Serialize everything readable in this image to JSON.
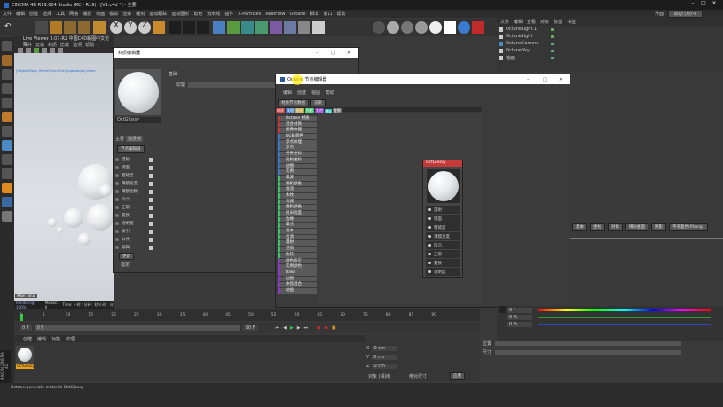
{
  "app": {
    "title": "CINEMA 4D R19.024 Studio (RC - R19) - [V1.c4d *] - 主要",
    "layout_label": "界面:",
    "layout_value": "启动 (用户)"
  },
  "menubar": [
    "文件",
    "编辑",
    "创建",
    "选择",
    "工具",
    "网格",
    "捕捉",
    "动画",
    "模拟",
    "渲染",
    "雕刻",
    "运动跟踪",
    "运动图形",
    "角色",
    "流水线",
    "插件",
    "X-Particles",
    "RealFlow",
    "Octane",
    "脚本",
    "窗口",
    "帮助"
  ],
  "viewport": {
    "header": "Live Viewer 3.07-R2 中国C4D新图中文论坛",
    "menu": [
      "文件",
      "云端",
      "材质",
      "比较",
      "选项",
      "帮助"
    ],
    "status_line": "[Object/Opic: Mesh/Gen:Ohm] update(all).done",
    "rendering_label": "Rendering: 100%",
    "ms_label": "Ms/sec: 0",
    "time_label": "Time: 小时 : 分钟 : 秒/小时 : 分钟 : 秒",
    "badge": "Main Tonal"
  },
  "material_editor": {
    "title": "材质编辑器",
    "name": "OctGlossy",
    "filter": "漫反射",
    "channel_label": "纹理",
    "node_editor_btn": "节点编辑器",
    "channels": [
      "漫射",
      "镜面",
      "粗糙度",
      "薄膜宽度",
      "薄膜指数",
      "凹凸",
      "正常",
      "置换",
      "透明度",
      "索引",
      "公共",
      "编辑"
    ],
    "update_btn": "更新",
    "assign_label": "指定",
    "tab_basic": "基础",
    "tab_main": "主要"
  },
  "node_editor": {
    "title": "Octane 节点编辑器",
    "menu": [
      "编辑",
      "创建",
      "视图",
      "帮助"
    ],
    "tabs": [
      "材质节点数据",
      "渲染"
    ],
    "categories": [
      "材质",
      "纹理",
      "贴图",
      "投影",
      "其他",
      "Mo",
      "变换"
    ],
    "left_items": [
      "Octane 材质",
      "混合材质",
      "图像纹理",
      "RGB 颜色",
      "浮点纹理",
      "浮点",
      "世界坐标",
      "投射坐标",
      "贴图",
      "实例",
      "噪波",
      "随机颜色",
      "湍流",
      "木纹",
      "衰减",
      "随机颜色",
      "脏旧程度",
      "边缘",
      "噪点",
      "泥水",
      "污渍",
      "漫射",
      "范围",
      "比较",
      "颜色校正",
      "实例颜色",
      "Bake",
      "贴图",
      "余弦混合",
      "动画"
    ],
    "node": {
      "title": "OctGlossy",
      "rows": [
        "漫射",
        "镜面",
        "粗糙度",
        "薄膜宽度",
        "凹凸",
        "正常",
        "置换",
        "透明度"
      ]
    }
  },
  "objects": {
    "menu": [
      "文件",
      "编辑",
      "查看",
      "对象",
      "标签",
      "书签"
    ],
    "items": [
      "OctaneLight.1",
      "OctaneLight",
      "OctaneCamera",
      "OctaneSky",
      "地面"
    ]
  },
  "attributes": {
    "tabs": [
      "基本",
      "坐标",
      "对象",
      "细分曲面",
      "阴影",
      "平滑着色(Phong)"
    ],
    "rows": [
      {
        "label": "H",
        "value": "0 °"
      },
      {
        "label": "S",
        "value": "0 %"
      },
      {
        "label": "V",
        "value": "0 %"
      }
    ],
    "coord_label": "0 cm"
  },
  "timeline": {
    "ticks": [
      "0",
      "5",
      "10",
      "15",
      "20",
      "25",
      "30",
      "35",
      "40",
      "45",
      "50",
      "55",
      "60",
      "65",
      "70",
      "75",
      "80",
      "85",
      "90"
    ],
    "frame_start": "0 F",
    "frame_end": "90 F",
    "current": "0 F"
  },
  "material_manager": {
    "menu": [
      "创建",
      "编辑",
      "功能",
      "纹理"
    ],
    "material_name": "OctGlossy"
  },
  "coordinates": {
    "position_label": "位置",
    "size_label": "尺寸",
    "rotation_label": "旋转",
    "x": "0 cm",
    "y": "0 cm",
    "z": "0 cm",
    "apply": "应用",
    "mode": "对象 (相对)",
    "size_mode": "绝对尺寸"
  },
  "status_bar": "Octane:generate material OctGlossy",
  "brand": "MAXON CINEMA 4D"
}
